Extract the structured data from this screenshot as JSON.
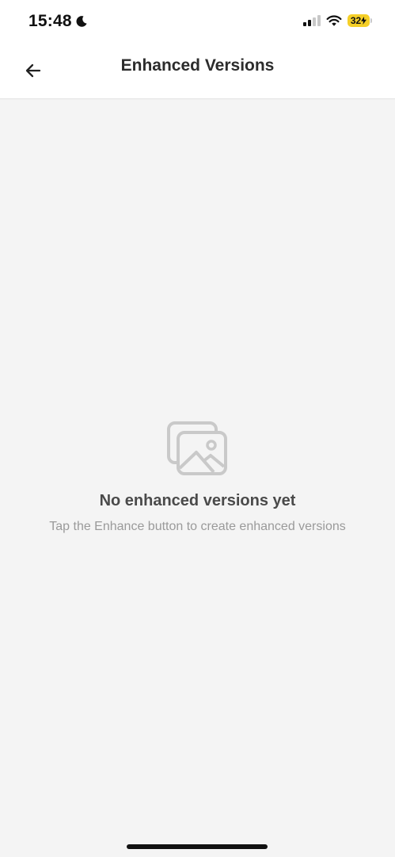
{
  "status_bar": {
    "time": "15:48",
    "battery_level": "32"
  },
  "nav": {
    "title": "Enhanced Versions"
  },
  "empty_state": {
    "icon": "images-icon",
    "title": "No enhanced versions yet",
    "subtitle": "Tap the Enhance button to create enhanced versions"
  },
  "colors": {
    "background": "#f4f4f4",
    "battery": "#f5cf27"
  }
}
